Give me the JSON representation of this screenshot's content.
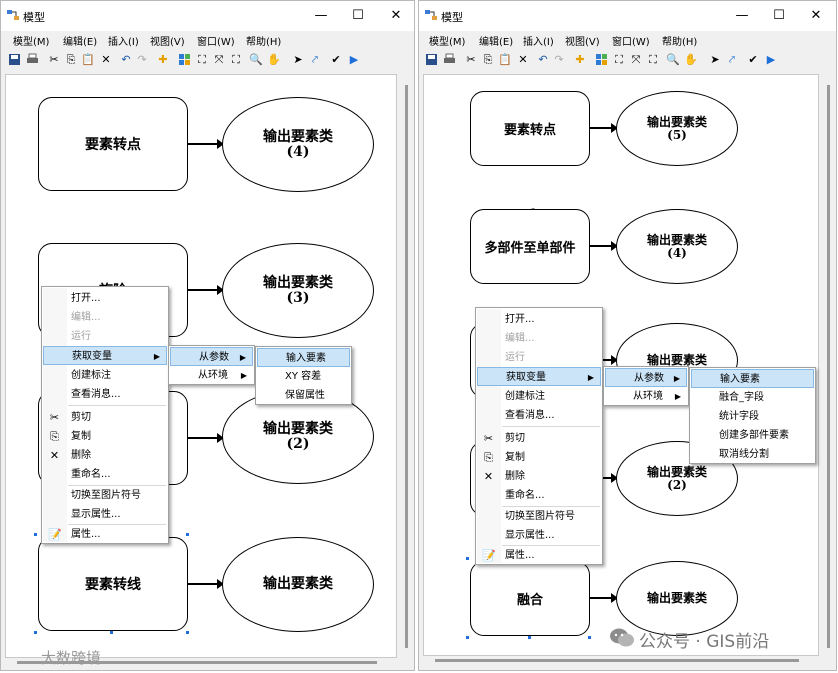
{
  "left": {
    "title": "模型",
    "window_buttons": {
      "minimize": "—",
      "maximize": "☐",
      "close": "✕"
    },
    "menubar": [
      "模型(M)",
      "编辑(E)",
      "插入(I)",
      "视图(V)",
      "窗口(W)",
      "帮助(H)"
    ],
    "nodes": {
      "n1": "要素转点",
      "n2": "旋险",
      "n4": "要素转线"
    },
    "outputs": {
      "o1": {
        "line1": "输出要素类",
        "line2": "(4)"
      },
      "o2": {
        "line1": "输出要素类",
        "line2": "(3)"
      },
      "o3": {
        "line1": "输出要素类",
        "line2": "(2)"
      },
      "o4": {
        "line1": "输出要素类",
        "line2": ""
      }
    },
    "context_menu": [
      {
        "label": "打开...",
        "enabled": true
      },
      {
        "label": "编辑...",
        "enabled": false
      },
      {
        "label": "运行",
        "enabled": false
      },
      {
        "label": "获取变量",
        "enabled": true,
        "submenu": true
      },
      {
        "label": "创建标注",
        "enabled": true
      },
      {
        "label": "查看消息...",
        "enabled": true
      },
      {
        "label": "剪切",
        "enabled": true,
        "icon": "scissors-icon"
      },
      {
        "label": "复制",
        "enabled": true,
        "icon": "copy-icon"
      },
      {
        "label": "删除",
        "enabled": true,
        "icon": "delete-icon"
      },
      {
        "label": "重命名...",
        "enabled": true
      },
      {
        "label": "切换至图片符号",
        "enabled": true
      },
      {
        "label": "显示属性...",
        "enabled": true
      },
      {
        "label": "属性...",
        "enabled": true,
        "icon": "properties-icon"
      }
    ],
    "submenu1": [
      "从参数",
      "从环境"
    ],
    "submenu2": [
      "输入要素",
      "XY 容差",
      "保留属性"
    ]
  },
  "right": {
    "title": "模型",
    "window_buttons": {
      "minimize": "—",
      "maximize": "☐",
      "close": "✕"
    },
    "menubar": [
      "模型(M)",
      "编辑(E)",
      "插入(I)",
      "视图(V)",
      "窗口(W)",
      "帮助(H)"
    ],
    "nodes": {
      "n1": "要素转点",
      "n2": "多部件至单部件",
      "n5": "融合"
    },
    "outputs": {
      "o1": {
        "line1": "输出要素类",
        "line2": "(5)"
      },
      "o2": {
        "line1": "输出要素类",
        "line2": "(4)"
      },
      "o3": {
        "line1": "输出要素类",
        "line2": ""
      },
      "o4": {
        "line1": "输出要素类",
        "line2": "(2)"
      },
      "o5": {
        "line1": "输出要素类",
        "line2": ""
      }
    },
    "context_menu": [
      {
        "label": "打开...",
        "enabled": true
      },
      {
        "label": "编辑...",
        "enabled": false
      },
      {
        "label": "运行",
        "enabled": false
      },
      {
        "label": "获取变量",
        "enabled": true,
        "submenu": true
      },
      {
        "label": "创建标注",
        "enabled": true
      },
      {
        "label": "查看消息...",
        "enabled": true
      },
      {
        "label": "剪切",
        "enabled": true,
        "icon": "scissors-icon"
      },
      {
        "label": "复制",
        "enabled": true,
        "icon": "copy-icon"
      },
      {
        "label": "删除",
        "enabled": true,
        "icon": "delete-icon"
      },
      {
        "label": "重命名...",
        "enabled": true
      },
      {
        "label": "切换至图片符号",
        "enabled": true
      },
      {
        "label": "显示属性...",
        "enabled": true
      },
      {
        "label": "属性...",
        "enabled": true,
        "icon": "properties-icon"
      }
    ],
    "submenu1": [
      "从参数",
      "从环境"
    ],
    "submenu2": [
      "输入要素",
      "融合_字段",
      "统计字段",
      "创建多部件要素",
      "取消线分割"
    ]
  },
  "watermarks": {
    "left": "大数跨境",
    "right": "公众号 · GIS前沿"
  },
  "colors": {
    "highlight": "#cce4f7",
    "highlight_border": "#88b8e4",
    "selection_handle": "#1e6fd9"
  }
}
